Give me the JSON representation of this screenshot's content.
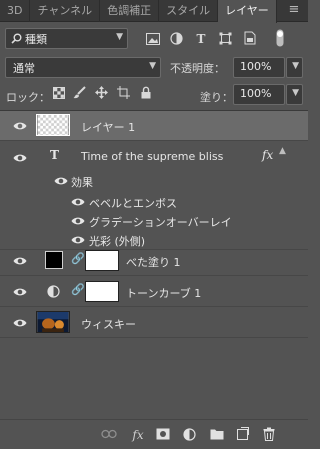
{
  "tabs": [
    "3D",
    "チャンネル",
    "色調補正",
    "スタイル",
    "レイヤー"
  ],
  "active_tab": "レイヤー",
  "filter": {
    "label": "種類"
  },
  "blend": {
    "mode": "通常",
    "opacity_label": "不透明度：",
    "opacity": "100%"
  },
  "lock": {
    "label": "ロック：",
    "fill_label": "塗り：",
    "fill": "100%"
  },
  "layers": {
    "text_layer": {
      "name": "レイヤー 1"
    },
    "style_layer": {
      "name": "Time of the supreme bliss",
      "fx": "fx"
    },
    "effects_label": "効果",
    "effects": [
      "ベベルとエンボス",
      "グラデーションオーバーレイ",
      "光彩 (外側)"
    ],
    "fill_layer": {
      "name": "べた塗り 1"
    },
    "curves_layer": {
      "name": "トーンカーブ 1"
    },
    "image_layer": {
      "name": "ウィスキー"
    }
  },
  "colors": {
    "panel": "#535353",
    "selected": "#6b6b6b",
    "tabbar": "#383838"
  }
}
